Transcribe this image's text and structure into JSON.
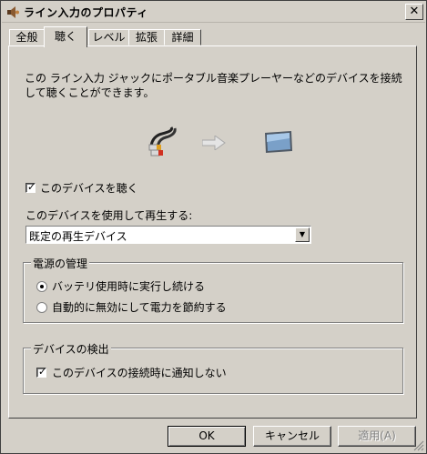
{
  "window": {
    "title": "ライン入力のプロパティ"
  },
  "tabs": [
    {
      "label": "全般",
      "active": false
    },
    {
      "label": "聴く",
      "active": true
    },
    {
      "label": "レベル",
      "active": false
    },
    {
      "label": "拡張",
      "active": false
    },
    {
      "label": "詳細",
      "active": false
    }
  ],
  "listen": {
    "description": "この ライン入力 ジャックにポータブル音楽プレーヤーなどのデバイスを接続して聴くことができます。",
    "listen_checkbox": {
      "label": "このデバイスを聴く",
      "checked": true
    },
    "playback_label": "このデバイスを使用して再生する:",
    "playback_select": {
      "value": "既定の再生デバイス"
    }
  },
  "power": {
    "title": "電源の管理",
    "options": [
      {
        "label": "バッテリ使用時に実行し続ける",
        "selected": true
      },
      {
        "label": "自動的に無効にして電力を節約する",
        "selected": false
      }
    ]
  },
  "detection": {
    "title": "デバイスの検出",
    "checkbox": {
      "label": "このデバイスの接続時に通知しない",
      "checked": true
    }
  },
  "buttons": {
    "ok": "OK",
    "cancel": "キャンセル",
    "apply": "適用(A)"
  },
  "icons": {
    "close": "close-icon",
    "cable": "audio-cable-icon",
    "arrow": "arrow-right-icon",
    "monitor": "monitor-icon"
  },
  "colors": {
    "face": "#d4d0c8",
    "shadow": "#808080",
    "highlight": "#ffffff"
  }
}
